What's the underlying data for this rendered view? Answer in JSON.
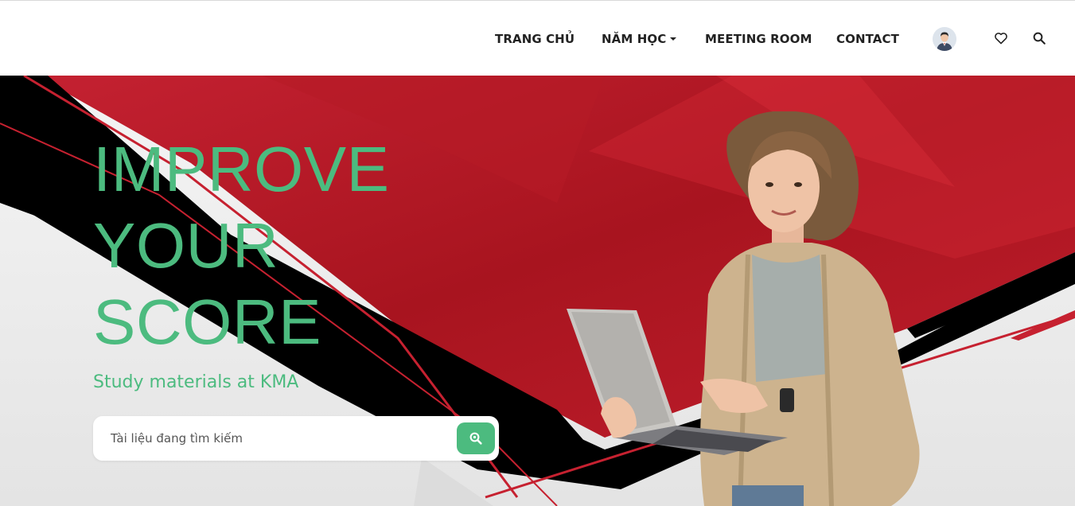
{
  "nav": {
    "items": [
      {
        "label": "TRANG CHỦ"
      },
      {
        "label": "NĂM HỌC",
        "has_dropdown": true
      },
      {
        "label": "MEETING ROOM"
      },
      {
        "label": "CONTACT"
      }
    ],
    "icons": [
      "user-avatar",
      "heart-icon",
      "search-icon"
    ]
  },
  "hero": {
    "title_lines": [
      "IMPROVE",
      "YOUR",
      "SCORE"
    ],
    "subtitle": "Study materials at KMA",
    "search": {
      "placeholder": "Tài liệu đang tìm kiếm",
      "button_icon": "search-icon"
    }
  },
  "colors": {
    "accent": "#4cbb7f",
    "hero_red": "#b81c28",
    "hero_black": "#000000",
    "nav_text": "#222222"
  }
}
